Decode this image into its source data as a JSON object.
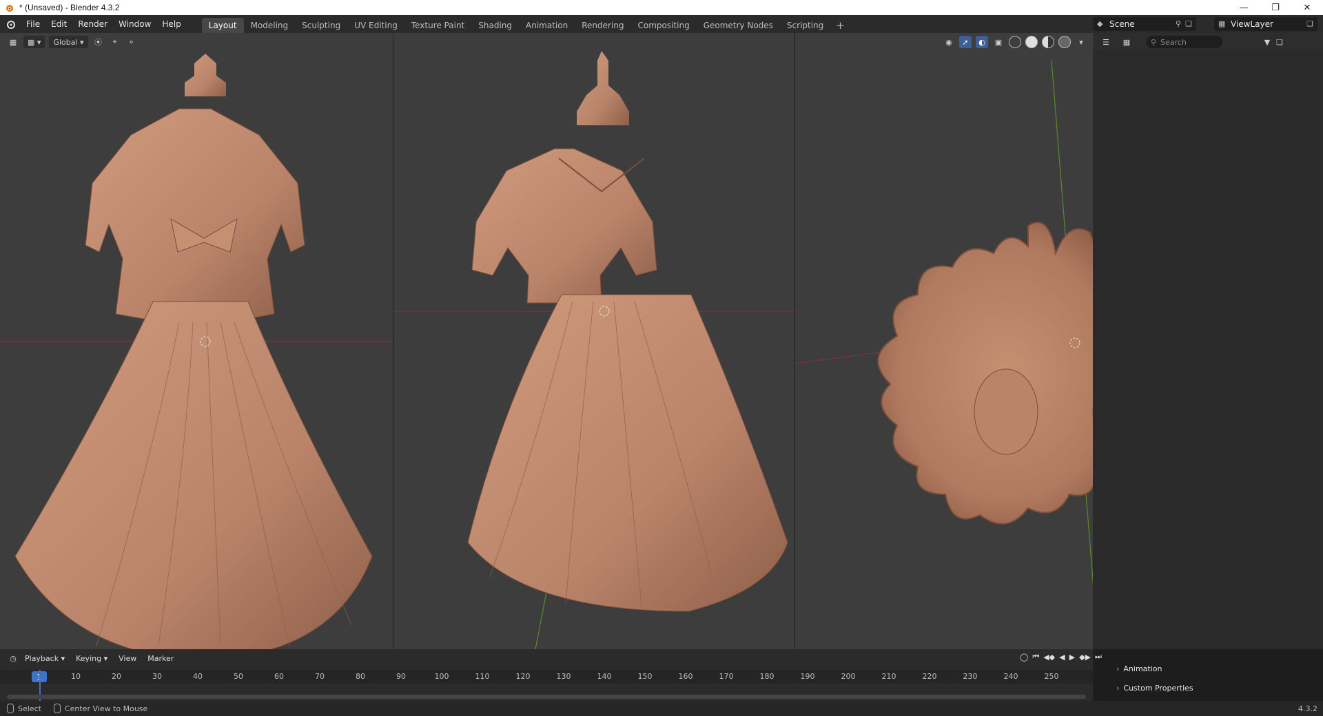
{
  "window": {
    "title": "* (Unsaved) - Blender 4.3.2",
    "controls": [
      "minimize-icon",
      "restore-icon",
      "close-icon"
    ]
  },
  "menu": [
    "File",
    "Edit",
    "Render",
    "Window",
    "Help"
  ],
  "workspaces": {
    "tabs": [
      "Layout",
      "Modeling",
      "Sculpting",
      "UV Editing",
      "Texture Paint",
      "Shading",
      "Animation",
      "Rendering",
      "Compositing",
      "Geometry Nodes",
      "Scripting"
    ],
    "active": "Layout",
    "add_label": "+"
  },
  "scene": {
    "name": "Scene",
    "view_layer": "ViewLayer"
  },
  "viewport_header": {
    "transform_orientation": "Global"
  },
  "outliner": {
    "search_placeholder": "Search"
  },
  "properties": {
    "panels": [
      "Animation",
      "Custom Properties"
    ]
  },
  "timeline": {
    "menus": [
      "Playback",
      "Keying",
      "View",
      "Marker"
    ],
    "current_frame": "1",
    "ticks": [
      "10",
      "20",
      "30",
      "40",
      "50",
      "60",
      "70",
      "80",
      "90",
      "100",
      "110",
      "120",
      "130",
      "140",
      "150",
      "160",
      "170",
      "180",
      "190",
      "200",
      "210",
      "220",
      "230",
      "240",
      "250"
    ],
    "controls": [
      "jump-start-icon",
      "prev-keyframe-icon",
      "play-reverse-icon",
      "play-icon",
      "next-keyframe-icon",
      "jump-end-icon"
    ]
  },
  "status": {
    "left_action": "Select",
    "middle_action": "Center View to Mouse",
    "version": "4.3.2"
  },
  "colors": {
    "clay": "#b9846a",
    "viewport_bg": "#3d3d3d",
    "accent_blue": "#3f74c4",
    "x_axis": "#a43a3a",
    "y_axis": "#6a9a2a"
  }
}
